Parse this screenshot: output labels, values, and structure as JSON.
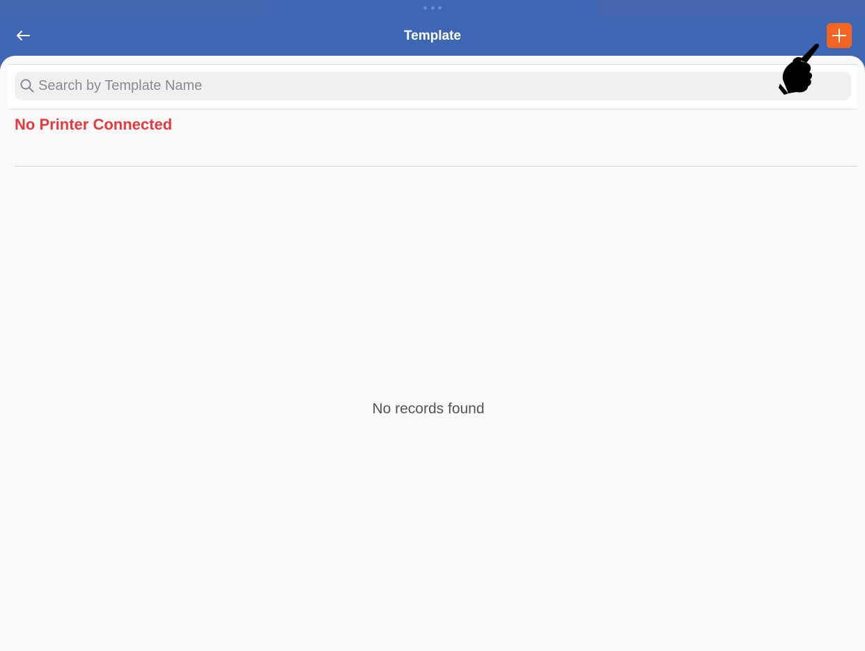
{
  "header": {
    "title": "Template"
  },
  "search": {
    "placeholder": "Search by Template Name",
    "value": ""
  },
  "printer": {
    "status": "No Printer Connected"
  },
  "list": {
    "empty_message": "No records found"
  },
  "colors": {
    "nav_bar": "#3d67b4",
    "add_button": "#f26522",
    "printer_status": "#e5393d",
    "background": "#f9f9f9"
  },
  "icons": {
    "back": "arrow-left-icon",
    "add": "plus-icon",
    "search": "magnifier-icon",
    "pointer": "pointing-hand-icon"
  }
}
